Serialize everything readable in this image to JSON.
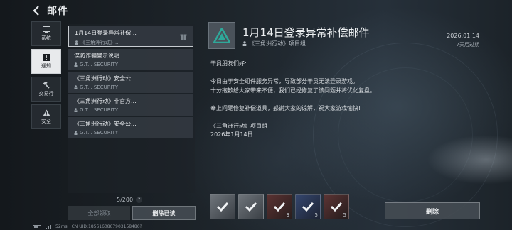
{
  "header": {
    "title": "邮件"
  },
  "nav": [
    {
      "label": "系统",
      "icon": "monitor-icon",
      "active": false
    },
    {
      "label": "通知",
      "icon": "alert-icon",
      "active": true
    },
    {
      "label": "交易行",
      "icon": "hammer-icon",
      "active": false
    },
    {
      "label": "安全",
      "icon": "warning-icon",
      "active": false
    }
  ],
  "mails": [
    {
      "title": "1月14日登录异常补偿...",
      "sender": "《三角洲行动》...",
      "has_attachment": true
    },
    {
      "title": "谍防诈骗警示说明",
      "sender": "G.T.I. SECURITY",
      "has_attachment": false
    },
    {
      "title": "《三角洲行动》安全公...",
      "sender": "G.T.I. SECURITY",
      "has_attachment": false
    },
    {
      "title": "《三角洲行动》非官方...",
      "sender": "G.T.I. SECURITY",
      "has_attachment": false
    },
    {
      "title": "《三角洲行动》安全公...",
      "sender": "G.T.I. SECURITY",
      "has_attachment": false
    }
  ],
  "list_footer": {
    "count": "5/200",
    "help": "?"
  },
  "buttons": {
    "claim_all": "全部领取",
    "delete_read": "删除已读",
    "delete": "删除"
  },
  "detail": {
    "title": "1月14日登录异常补偿邮件",
    "sender": "《三角洲行动》项目组",
    "date": "2026.01.14",
    "expire": "7天后过期",
    "body": [
      "干员朋友们好:",
      "",
      "今日由于安全组件服务异常，导致部分干员无法登录游戏。",
      "十分抱歉给大家带来不便，我们已经修复了该问题并将优化复盘。",
      "",
      "奉上问题修复补偿道具，感谢大家的谅解，祝大家游戏愉快!",
      "",
      "《三角洲行动》项目组",
      "2026年1月14日"
    ]
  },
  "attachments": [
    {
      "qty": "",
      "color": "#8a8f94"
    },
    {
      "qty": "",
      "color": "#8a8f94"
    },
    {
      "qty": "3",
      "color": "#7a3b3b"
    },
    {
      "qty": "5",
      "color": "#3a4d7a"
    },
    {
      "qty": "5",
      "color": "#6b3a3a"
    }
  ],
  "status_bar": {
    "ping": "52ms",
    "uid": "CN UID:1856160867903158486?"
  },
  "colors": {
    "accent": "#2fa89a",
    "selected_nav": "#e8eaec"
  }
}
